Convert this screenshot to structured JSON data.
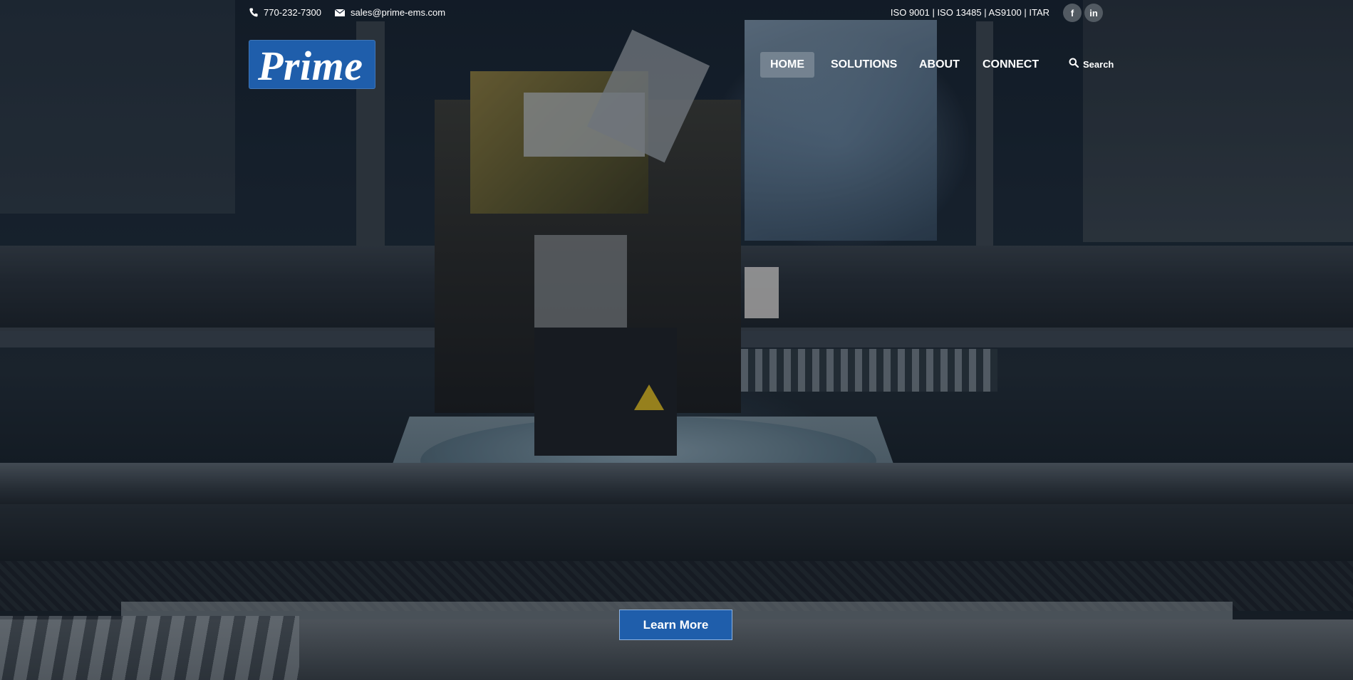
{
  "topbar": {
    "phone": "770-232-7300",
    "email": "sales@prime-ems.com",
    "certifications": "ISO 9001 | ISO 13485 | AS9100 | ITAR",
    "social": [
      {
        "icon": "facebook-icon",
        "glyph": "f"
      },
      {
        "icon": "linkedin-icon",
        "glyph": "in"
      }
    ]
  },
  "header": {
    "logo_text": "Prime"
  },
  "nav": {
    "items": [
      "HOME",
      "SOLUTIONS",
      "ABOUT",
      "CONNECT"
    ],
    "active": "HOME",
    "search_label": "Search"
  },
  "hero": {
    "cta_label": "Learn More"
  },
  "colors": {
    "brand_blue": "#1f5eab",
    "overlay": "#081220"
  }
}
